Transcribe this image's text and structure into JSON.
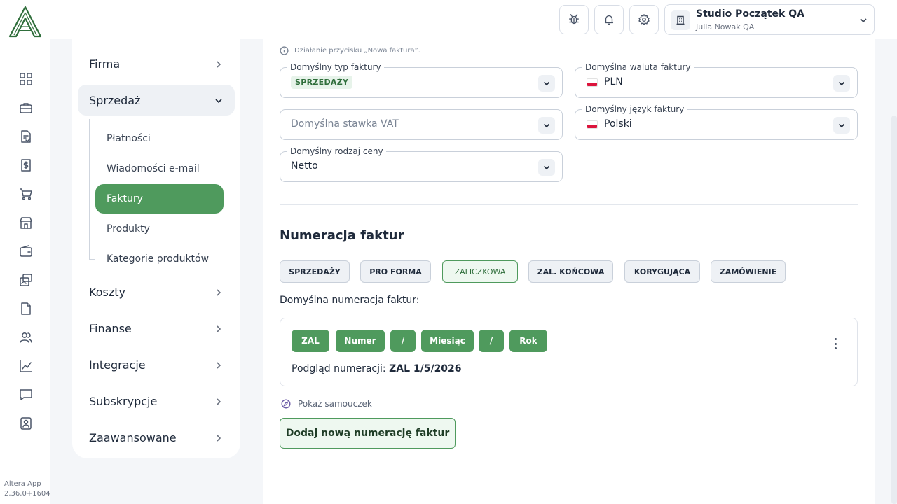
{
  "app": {
    "name_version": "Altera App",
    "version": "2.36.0+1604",
    "logo_letter": "A"
  },
  "rail": {
    "icons": [
      "dashboard-icon",
      "briefcase-icon",
      "document-check-icon",
      "invoice-dollar-icon",
      "cart-icon",
      "store-icon",
      "wallet-icon",
      "images-icon",
      "file-icon",
      "users-icon",
      "chart-line-icon",
      "chat-icon",
      "contact-card-icon"
    ]
  },
  "topbar": {
    "org_name": "Studio Początek QA",
    "org_user": "Julia Nowak QA"
  },
  "sidenav": {
    "items": [
      {
        "label": "Firma"
      },
      {
        "label": "Sprzedaż"
      },
      {
        "label": "Koszty"
      },
      {
        "label": "Finanse"
      },
      {
        "label": "Integracje"
      },
      {
        "label": "Subskrypcje"
      },
      {
        "label": "Zaawansowane"
      }
    ],
    "sub_items": [
      {
        "label": "Płatności"
      },
      {
        "label": "Wiadomości e-mail"
      },
      {
        "label": "Faktury"
      },
      {
        "label": "Produkty"
      },
      {
        "label": "Kategorie produktów"
      }
    ]
  },
  "main": {
    "hint": "Działanie przycisku „Nowa faktura”.",
    "fields": {
      "invoice_type": {
        "label": "Domyślny typ faktury",
        "value": "SPRZEDAŻY"
      },
      "currency": {
        "label": "Domyślna waluta faktury",
        "value": "PLN"
      },
      "vat_rate": {
        "placeholder": "Domyślna stawka VAT"
      },
      "language": {
        "label": "Domyślny język faktury",
        "value": "Polski"
      },
      "price_type": {
        "label": "Domyślny rodzaj ceny",
        "value": "Netto"
      }
    },
    "numbering_title": "Numeracja faktur",
    "types": [
      {
        "label": "SPRZEDAŻY"
      },
      {
        "label": "PRO FORMA"
      },
      {
        "label": "ZALICZKOWA"
      },
      {
        "label": "ZAL. KOŃCOWA"
      },
      {
        "label": "KORYGUJĄCA"
      },
      {
        "label": "ZAMÓWIENIE"
      }
    ],
    "default_numbering_label": "Domyślna numeracja faktur:",
    "chips": [
      "ZAL",
      "Numer",
      "/",
      "Miesiąc",
      "/",
      "Rok"
    ],
    "preview_label": "Podgląd numeracji:",
    "preview_value": "ZAL 1/5/2026",
    "tutorial": "Pokaż samouczek",
    "add_button": "Dodaj nową numerację faktur"
  },
  "colors": {
    "accent": "#4f9a5d",
    "accent_light": "#eef8f0"
  }
}
